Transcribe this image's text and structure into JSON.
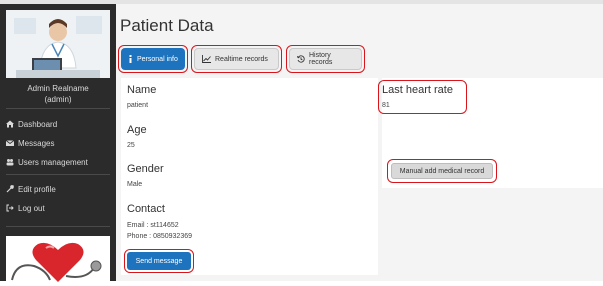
{
  "sidebar": {
    "user_name": "Admin Realname",
    "user_role": "(admin)",
    "items": [
      {
        "label": "Dashboard",
        "icon": "home-icon"
      },
      {
        "label": "Messages",
        "icon": "envelope-icon"
      },
      {
        "label": "Users management",
        "icon": "users-icon"
      },
      {
        "label": "Edit profile",
        "icon": "wrench-icon"
      },
      {
        "label": "Log out",
        "icon": "sign-out-icon"
      }
    ]
  },
  "page": {
    "title": "Patient Data"
  },
  "tabs": [
    {
      "label": "Personal info",
      "icon": "info-icon",
      "active": true
    },
    {
      "label": "Realtime records",
      "icon": "line-chart-icon",
      "active": false
    },
    {
      "label": "History records",
      "icon": "history-icon",
      "active": false
    }
  ],
  "patient": {
    "name_label": "Name",
    "name_value": "patient",
    "age_label": "Age",
    "age_value": "25",
    "gender_label": "Gender",
    "gender_value": "Male",
    "contact_label": "Contact",
    "email_value": "Email : st114652",
    "phone_value": "Phone : 0850932369",
    "send_button": "Send message"
  },
  "heart": {
    "label": "Last heart rate",
    "value": "81",
    "manual_button": "Manual add medical record"
  },
  "colors": {
    "sidebar_bg": "#2b2b2b",
    "primary": "#1e73be",
    "highlight": "#d9141b",
    "main_bg": "#f4f4f4"
  }
}
